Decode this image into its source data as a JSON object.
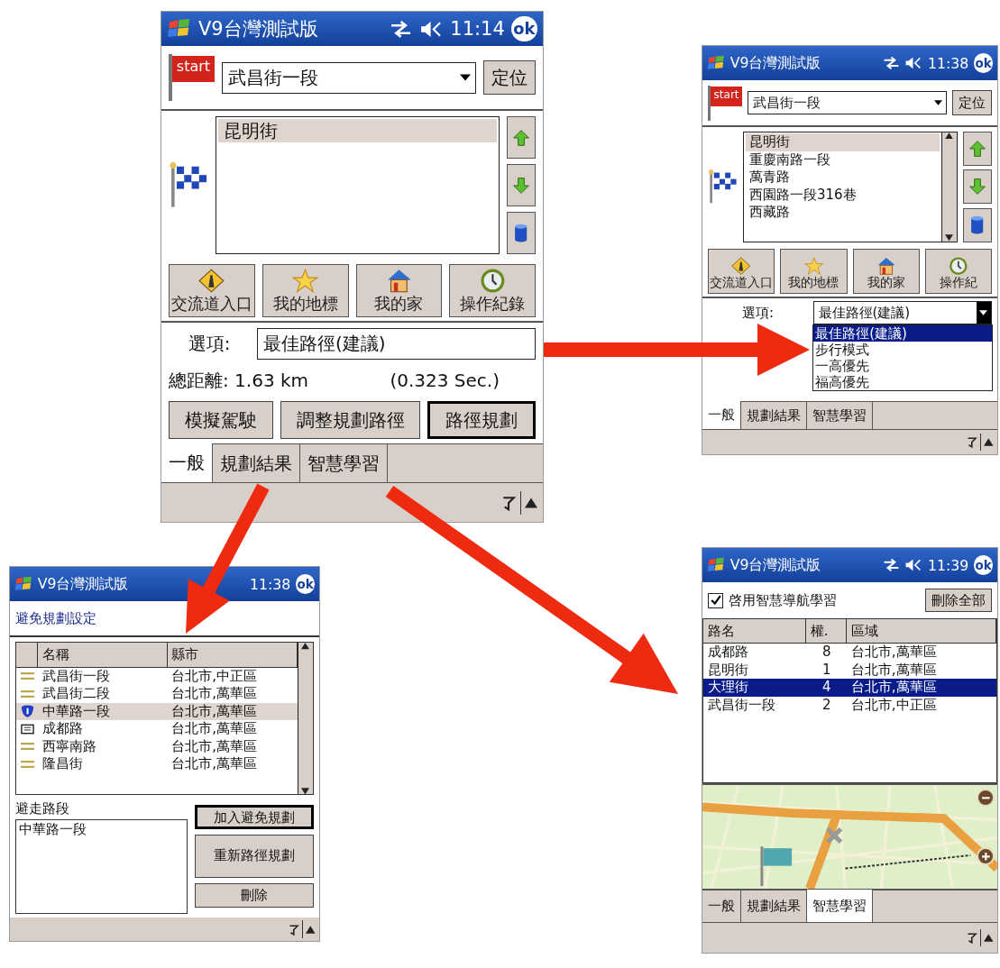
{
  "main_screen": {
    "title": "V9台灣測試版",
    "time": "11:14",
    "ok": "ok",
    "start_flag": "start",
    "start_street": "武昌街一段",
    "locate_button": "定位",
    "destinations": [
      {
        "label": "昆明街",
        "selected": true
      }
    ],
    "shortcuts": [
      {
        "kind": "interchange",
        "label": "交流道入口"
      },
      {
        "kind": "favorite",
        "label": "我的地標"
      },
      {
        "kind": "home",
        "label": "我的家"
      },
      {
        "kind": "history",
        "label": "操作紀錄"
      }
    ],
    "option_label": "選項:",
    "option_value": "最佳路徑(建議)",
    "distance": "總距離: 1.63 km",
    "elapsed": "(0.323 Sec.)",
    "actions": [
      {
        "label": "模擬駕駛",
        "default": false
      },
      {
        "label": "調整規劃路徑",
        "default": false
      },
      {
        "label": "路徑規劃",
        "default": true
      }
    ],
    "tabs": [
      {
        "label": "一般",
        "selected": true
      },
      {
        "label": "規劃結果",
        "selected": false
      },
      {
        "label": "智慧學習",
        "selected": false
      }
    ]
  },
  "options_screen": {
    "title": "V9台灣測試版",
    "time": "11:38",
    "ok": "ok",
    "start_flag": "start",
    "start_street": "武昌街一段",
    "locate_button": "定位",
    "destinations": [
      {
        "label": "昆明街",
        "selected": true
      },
      {
        "label": "重慶南路一段",
        "selected": false
      },
      {
        "label": "萬青路",
        "selected": false
      },
      {
        "label": "西園路一段316巷",
        "selected": false
      },
      {
        "label": "西藏路",
        "selected": false
      }
    ],
    "shortcuts": [
      {
        "kind": "interchange",
        "label": "交流道入口"
      },
      {
        "kind": "favorite",
        "label": "我的地標"
      },
      {
        "kind": "home",
        "label": "我的家"
      },
      {
        "kind": "history",
        "label": "操作紀"
      }
    ],
    "option_label": "選項:",
    "option_value": "最佳路徑(建議)",
    "option_menu": [
      {
        "label": "最佳路徑(建議)",
        "selected": true
      },
      {
        "label": "步行模式",
        "selected": false
      },
      {
        "label": "一高優先",
        "selected": false
      },
      {
        "label": "福高優先",
        "selected": false
      }
    ],
    "tabs": [
      {
        "label": "一般",
        "selected": true
      },
      {
        "label": "規劃結果",
        "selected": false
      },
      {
        "label": "智慧學習",
        "selected": false
      }
    ]
  },
  "avoid_screen": {
    "title": "V9台灣測試版",
    "time": "11:38",
    "ok": "ok",
    "heading": "避免規劃設定",
    "columns": [
      "名稱",
      "縣市"
    ],
    "rows": [
      {
        "kind": "road",
        "name": "武昌街一段",
        "city": "台北市,中正區",
        "selected": false
      },
      {
        "kind": "road",
        "name": "武昌街二段",
        "city": "台北市,萬華區",
        "selected": false
      },
      {
        "kind": "highway",
        "name": "中華路一段",
        "city": "台北市,萬華區",
        "selected": true
      },
      {
        "kind": "numbered",
        "name": "成都路",
        "city": "台北市,萬華區",
        "selected": false
      },
      {
        "kind": "road",
        "name": "西寧南路",
        "city": "台北市,萬華區",
        "selected": false
      },
      {
        "kind": "road",
        "name": "隆昌街",
        "city": "台北市,萬華區",
        "selected": false
      }
    ],
    "avoided_label": "避走路段",
    "avoided": [
      "中華路一段"
    ],
    "buttons": [
      {
        "label": "加入避免規劃",
        "default": true
      },
      {
        "label": "重新路徑規劃",
        "default": false
      },
      {
        "label": "刪除",
        "default": false
      }
    ]
  },
  "learning_screen": {
    "title": "V9台灣測試版",
    "time": "11:39",
    "ok": "ok",
    "enable": {
      "label": "啓用智慧導航學習",
      "checked": true
    },
    "delete_all": "刪除全部",
    "columns": [
      "路名",
      "權.",
      "區域"
    ],
    "rows": [
      {
        "name": "成都路",
        "weight": "8",
        "area": "台北市,萬華區",
        "selected": false
      },
      {
        "name": "昆明街",
        "weight": "1",
        "area": "台北市,萬華區",
        "selected": false
      },
      {
        "name": "大理街",
        "weight": "4",
        "area": "台北市,萬華區",
        "selected": true
      },
      {
        "name": "武昌街一段",
        "weight": "2",
        "area": "台北市,中正區",
        "selected": false
      }
    ],
    "tabs": [
      {
        "label": "一般",
        "selected": false
      },
      {
        "label": "規劃結果",
        "selected": false
      },
      {
        "label": "智慧學習",
        "selected": true
      }
    ]
  }
}
